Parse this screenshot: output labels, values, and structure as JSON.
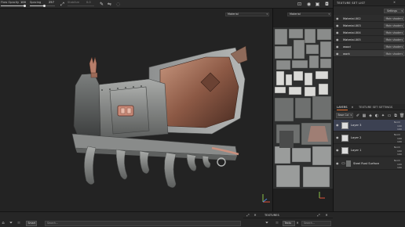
{
  "toolbar": {
    "opacity_label": "Flow Opacity",
    "opacity_value": "100",
    "opacity_fraction": 1.0,
    "spacing_label": "Spacing",
    "spacing_value": "257",
    "spacing_fraction": 0.55,
    "third_label": "Stabilize",
    "third_value": "0.0"
  },
  "viewport": {
    "material_select_3d": "Material",
    "material_select_2d": "Material"
  },
  "texture_set_list": {
    "title": "TEXTURE SET LIST",
    "settings_label": "Settings",
    "rows": [
      {
        "name": "Material.002",
        "shader": "Main shader"
      },
      {
        "name": "Material.003",
        "shader": "Main shader"
      },
      {
        "name": "Material.004",
        "shader": "Main shader"
      },
      {
        "name": "Material.005",
        "shader": "Main shader"
      },
      {
        "name": "wood",
        "shader": "Main shader"
      },
      {
        "name": "work",
        "shader": "Main shader"
      }
    ]
  },
  "layers_panel": {
    "tab_layers": "LAYERS",
    "tab_settings": "TEXTURE SET SETTINGS",
    "channel_select": "Base Col",
    "layers": [
      {
        "name": "Layer 3",
        "blend": "Norm",
        "opacity": "100",
        "opacity2": "100"
      },
      {
        "name": "Layer 2",
        "blend": "Norm",
        "opacity": "100",
        "opacity2": "100"
      },
      {
        "name": "Layer 1",
        "blend": "Norm",
        "opacity": "100",
        "opacity2": "100"
      },
      {
        "name": "Steel Rust Surface",
        "blend": "Norm",
        "opacity": "100",
        "opacity2": "100"
      }
    ]
  },
  "bottom": {
    "shelf_title": "TEXTURES",
    "search_placeholder": "Search...",
    "chip_smart": "Smart",
    "chip_texture": "Textu",
    "search2_placeholder": "Search..."
  },
  "colors": {
    "accent": "#e06a2a",
    "selection": "#3c4152"
  }
}
